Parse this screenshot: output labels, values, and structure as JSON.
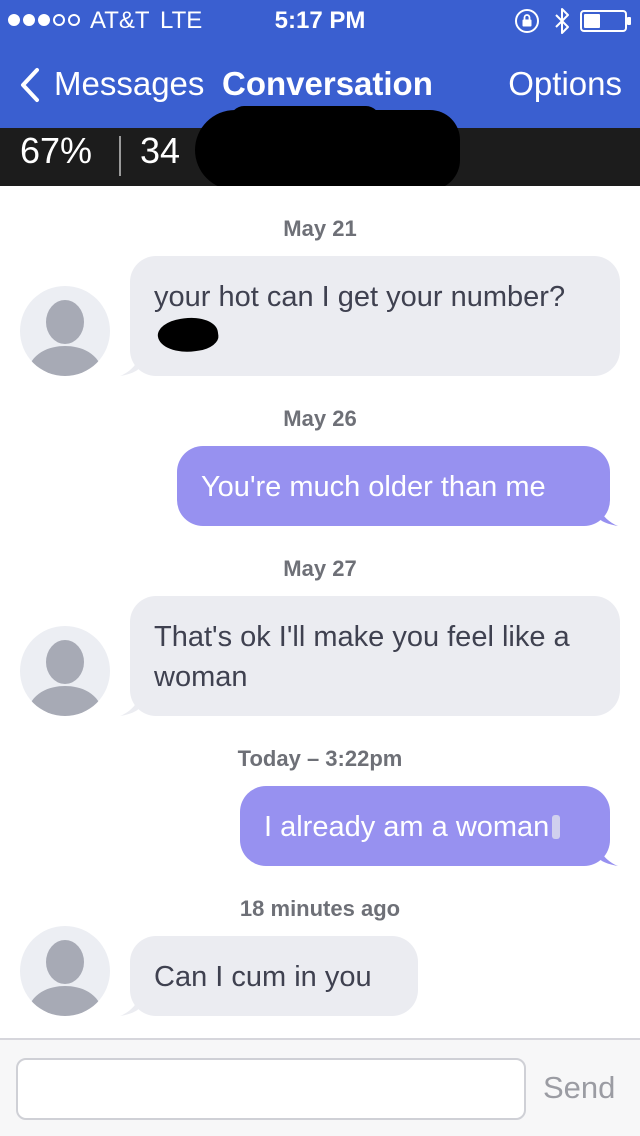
{
  "status_bar": {
    "carrier": "AT&T",
    "network": "LTE",
    "time": "5:17 PM",
    "signal_bars_filled": 3,
    "signal_bars_total": 5
  },
  "nav": {
    "back_label": "Messages",
    "title": "Conversation",
    "options_label": "Options"
  },
  "match": {
    "percent": "67%",
    "age": "34"
  },
  "thread": {
    "items": [
      {
        "type": "date",
        "text": "May 21"
      },
      {
        "type": "message",
        "direction": "incoming",
        "text": "your hot can I get your number?"
      },
      {
        "type": "date",
        "text": "May 26"
      },
      {
        "type": "message",
        "direction": "outgoing",
        "text": "You're much older than me"
      },
      {
        "type": "date",
        "text": "May 27"
      },
      {
        "type": "message",
        "direction": "incoming",
        "text": "That's ok I'll make you feel like a woman"
      },
      {
        "type": "date",
        "text": "Today – 3:22pm"
      },
      {
        "type": "message",
        "direction": "outgoing",
        "text": "I already am a woman"
      },
      {
        "type": "date",
        "text": "18 minutes ago"
      },
      {
        "type": "message",
        "direction": "incoming",
        "text": "Can I cum in you"
      }
    ]
  },
  "composer": {
    "input_value": "",
    "input_placeholder": "",
    "send_label": "Send"
  },
  "colors": {
    "header_bg": "#3a5fd0",
    "stats_bg": "#1c1c1c",
    "incoming_bubble": "#ebecf1",
    "outgoing_bubble": "#9791f0"
  },
  "icons": [
    "back-chevron-icon",
    "lock-rotation-icon",
    "bluetooth-icon",
    "battery-icon",
    "avatar-placeholder-icon"
  ]
}
